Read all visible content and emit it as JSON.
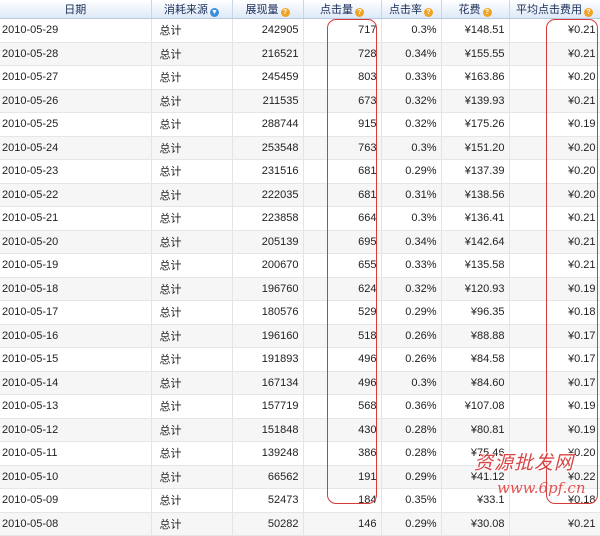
{
  "table": {
    "columns": {
      "date": "日期",
      "source": "消耗来源",
      "impressions": "展现量",
      "clicks": "点击量",
      "ctr": "点击率",
      "cost": "花费",
      "avg_cpc": "平均点击费用"
    },
    "rows": [
      {
        "date": "2010-05-29",
        "source": "总计",
        "impressions": "242905",
        "clicks": "717",
        "ctr": "0.3%",
        "cost": "¥148.51",
        "avg_cpc": "¥0.21"
      },
      {
        "date": "2010-05-28",
        "source": "总计",
        "impressions": "216521",
        "clicks": "728",
        "ctr": "0.34%",
        "cost": "¥155.55",
        "avg_cpc": "¥0.21"
      },
      {
        "date": "2010-05-27",
        "source": "总计",
        "impressions": "245459",
        "clicks": "803",
        "ctr": "0.33%",
        "cost": "¥163.86",
        "avg_cpc": "¥0.20"
      },
      {
        "date": "2010-05-26",
        "source": "总计",
        "impressions": "211535",
        "clicks": "673",
        "ctr": "0.32%",
        "cost": "¥139.93",
        "avg_cpc": "¥0.21"
      },
      {
        "date": "2010-05-25",
        "source": "总计",
        "impressions": "288744",
        "clicks": "915",
        "ctr": "0.32%",
        "cost": "¥175.26",
        "avg_cpc": "¥0.19"
      },
      {
        "date": "2010-05-24",
        "source": "总计",
        "impressions": "253548",
        "clicks": "763",
        "ctr": "0.3%",
        "cost": "¥151.20",
        "avg_cpc": "¥0.20"
      },
      {
        "date": "2010-05-23",
        "source": "总计",
        "impressions": "231516",
        "clicks": "681",
        "ctr": "0.29%",
        "cost": "¥137.39",
        "avg_cpc": "¥0.20"
      },
      {
        "date": "2010-05-22",
        "source": "总计",
        "impressions": "222035",
        "clicks": "681",
        "ctr": "0.31%",
        "cost": "¥138.56",
        "avg_cpc": "¥0.20"
      },
      {
        "date": "2010-05-21",
        "source": "总计",
        "impressions": "223858",
        "clicks": "664",
        "ctr": "0.3%",
        "cost": "¥136.41",
        "avg_cpc": "¥0.21"
      },
      {
        "date": "2010-05-20",
        "source": "总计",
        "impressions": "205139",
        "clicks": "695",
        "ctr": "0.34%",
        "cost": "¥142.64",
        "avg_cpc": "¥0.21"
      },
      {
        "date": "2010-05-19",
        "source": "总计",
        "impressions": "200670",
        "clicks": "655",
        "ctr": "0.33%",
        "cost": "¥135.58",
        "avg_cpc": "¥0.21"
      },
      {
        "date": "2010-05-18",
        "source": "总计",
        "impressions": "196760",
        "clicks": "624",
        "ctr": "0.32%",
        "cost": "¥120.93",
        "avg_cpc": "¥0.19"
      },
      {
        "date": "2010-05-17",
        "source": "总计",
        "impressions": "180576",
        "clicks": "529",
        "ctr": "0.29%",
        "cost": "¥96.35",
        "avg_cpc": "¥0.18"
      },
      {
        "date": "2010-05-16",
        "source": "总计",
        "impressions": "196160",
        "clicks": "518",
        "ctr": "0.26%",
        "cost": "¥88.88",
        "avg_cpc": "¥0.17"
      },
      {
        "date": "2010-05-15",
        "source": "总计",
        "impressions": "191893",
        "clicks": "496",
        "ctr": "0.26%",
        "cost": "¥84.58",
        "avg_cpc": "¥0.17"
      },
      {
        "date": "2010-05-14",
        "source": "总计",
        "impressions": "167134",
        "clicks": "496",
        "ctr": "0.3%",
        "cost": "¥84.60",
        "avg_cpc": "¥0.17"
      },
      {
        "date": "2010-05-13",
        "source": "总计",
        "impressions": "157719",
        "clicks": "568",
        "ctr": "0.36%",
        "cost": "¥107.08",
        "avg_cpc": "¥0.19"
      },
      {
        "date": "2010-05-12",
        "source": "总计",
        "impressions": "151848",
        "clicks": "430",
        "ctr": "0.28%",
        "cost": "¥80.81",
        "avg_cpc": "¥0.19"
      },
      {
        "date": "2010-05-11",
        "source": "总计",
        "impressions": "139248",
        "clicks": "386",
        "ctr": "0.28%",
        "cost": "¥75.46",
        "avg_cpc": "¥0.20"
      },
      {
        "date": "2010-05-10",
        "source": "总计",
        "impressions": "66562",
        "clicks": "191",
        "ctr": "0.29%",
        "cost": "¥41.12",
        "avg_cpc": "¥0.22"
      },
      {
        "date": "2010-05-09",
        "source": "总计",
        "impressions": "52473",
        "clicks": "184",
        "ctr": "0.35%",
        "cost": "¥33.1",
        "avg_cpc": "¥0.18"
      },
      {
        "date": "2010-05-08",
        "source": "总计",
        "impressions": "50282",
        "clicks": "146",
        "ctr": "0.29%",
        "cost": "¥30.08",
        "avg_cpc": "¥0.21"
      }
    ]
  },
  "icons": {
    "help": "help-question-icon",
    "source_dropdown": "chevron-down-icon"
  },
  "colors": {
    "annotation_outline": "#d63b3b",
    "watermark": "#d83030",
    "header_text": "#1c2f5a"
  },
  "watermark": {
    "chinese": "资源批发网",
    "url": "www.6pf.cn"
  }
}
